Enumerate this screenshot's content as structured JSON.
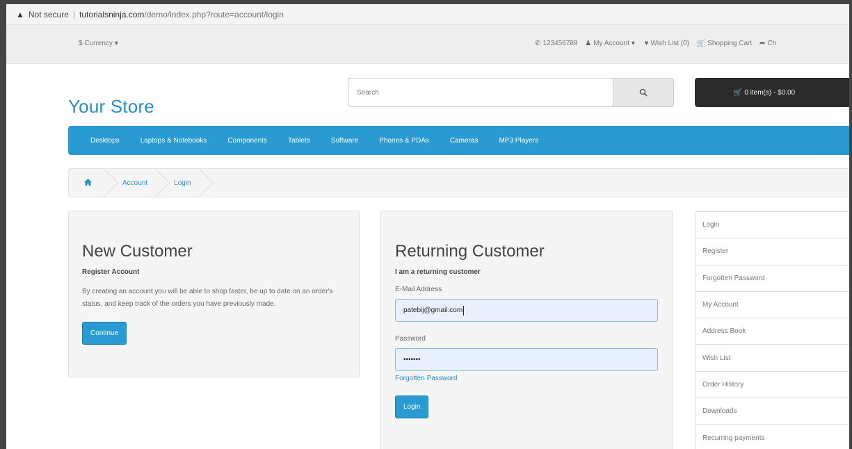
{
  "browser": {
    "security_label": "Not secure",
    "url_host": "tutorialsninja.com",
    "url_path": "/demo/index.php?route=account/login"
  },
  "topbar": {
    "currency": "$ Currency",
    "phone": "123456789",
    "my_account": "My Account",
    "wish_list": "Wish List (0)",
    "shopping_cart": "Shopping Cart",
    "checkout": "Ch"
  },
  "header": {
    "logo": "Your Store",
    "search_placeholder": "Search",
    "cart_button": "0 item(s) - $0.00"
  },
  "menu": {
    "items": [
      "Desktops",
      "Laptops & Notebooks",
      "Components",
      "Tablets",
      "Software",
      "Phones & PDAs",
      "Cameras",
      "MP3 Players"
    ]
  },
  "breadcrumb": {
    "items": [
      "Account",
      "Login"
    ]
  },
  "new_customer": {
    "title": "New Customer",
    "subtitle": "Register Account",
    "body": "By creating an account you will be able to shop faster, be up to date on an order's status, and keep track of the orders you have previously made.",
    "continue_label": "Continue"
  },
  "returning_customer": {
    "title": "Returning Customer",
    "subtitle": "I am a returning customer",
    "email_label": "E-Mail Address",
    "email_value": "patebij@gmail.com",
    "password_label": "Password",
    "password_value": "•••••••",
    "forgotten_link": "Forgotten Password",
    "login_label": "Login"
  },
  "account_list": {
    "items": [
      "Login",
      "Register",
      "Forgotten Password",
      "My Account",
      "Address Book",
      "Wish List",
      "Order History",
      "Downloads",
      "Recurring payments"
    ]
  },
  "icons": {
    "warning": "warning-icon",
    "phone": "phone-icon",
    "user": "user-icon",
    "heart": "heart-icon",
    "cart": "cart-icon",
    "share": "share-icon",
    "search": "search-icon",
    "home": "home-icon"
  },
  "colors": {
    "accent": "#2a9bd2",
    "link": "#2a8fc7",
    "cart_bg": "#2b2b2b"
  }
}
